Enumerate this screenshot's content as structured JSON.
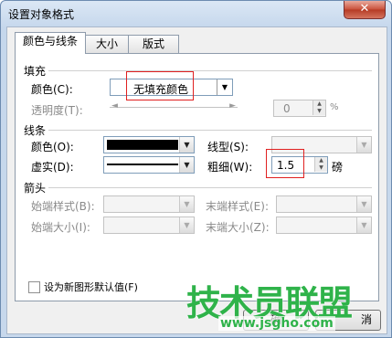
{
  "window": {
    "title": "设置对象格式",
    "close": "✕"
  },
  "tabs": [
    {
      "label": "颜色与线条",
      "active": true
    },
    {
      "label": "大小",
      "active": false
    },
    {
      "label": "版式",
      "active": false
    }
  ],
  "fill": {
    "section": "填充",
    "color_label": "颜色(C):",
    "color_value": "无填充颜色",
    "transparency_label": "透明度(T):",
    "transparency_value": "0",
    "transparency_unit": "%"
  },
  "line": {
    "section": "线条",
    "color_label": "颜色(O):",
    "color_value": "#000000",
    "dash_label": "虚实(D):",
    "style_label": "线型(S):",
    "weight_label": "粗细(W):",
    "weight_value": "1.5",
    "weight_unit": "磅"
  },
  "arrows": {
    "section": "箭头",
    "begin_style_label": "始端样式(B):",
    "end_style_label": "末端样式(E):",
    "begin_size_label": "始端大小(I):",
    "end_size_label": "末端大小(Z):"
  },
  "default_checkbox": "设为新图形默认值(F)",
  "buttons": {
    "ok_partial": "确",
    "cancel_partial": "消"
  },
  "watermark": {
    "brand": "技术员联盟",
    "url": "www.jsgho.com"
  },
  "colors": {
    "highlight": "#e02020",
    "watermark": "#2fb34a"
  }
}
